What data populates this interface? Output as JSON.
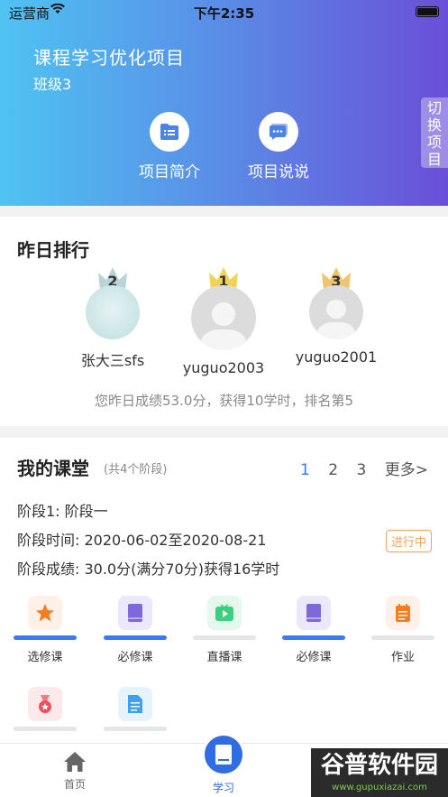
{
  "status_bar": {
    "carrier": "运营商",
    "time": "下午2:35"
  },
  "header": {
    "project_title": "课程学习优化项目",
    "class_name": "班级3",
    "buttons": [
      {
        "label": "项目简介",
        "icon": "list-icon"
      },
      {
        "label": "项目说说",
        "icon": "chat-icon"
      }
    ],
    "switch_label": "切换项目"
  },
  "ranking": {
    "title": "昨日排行",
    "items": [
      {
        "rank": "2",
        "name": "张大三sfs"
      },
      {
        "rank": "1",
        "name": "yuguo2003"
      },
      {
        "rank": "3",
        "name": "yuguo2001"
      }
    ],
    "summary": "您昨日成绩53.0分，获得10学时，排名第5"
  },
  "classroom": {
    "title": "我的课堂",
    "subtitle": "(共4个阶段)",
    "pages": [
      "1",
      "2",
      "3"
    ],
    "more": "更多>",
    "stage_name": "阶段1: 阶段一",
    "stage_time": "阶段时间: 2020-06-02至2020-08-21",
    "stage_score": "阶段成绩: 30.0分(满分70分)获得16学时",
    "status": "进行中",
    "courses": [
      {
        "label": "选修课",
        "icon": "star-icon",
        "progress": 1
      },
      {
        "label": "必修课",
        "icon": "book-icon",
        "progress": 1
      },
      {
        "label": "直播课",
        "icon": "video-icon",
        "progress": 0
      },
      {
        "label": "必修课",
        "icon": "book-icon",
        "progress": 1
      },
      {
        "label": "作业",
        "icon": "notebook-icon",
        "progress": 0
      },
      {
        "label": "",
        "icon": "medal-icon",
        "progress": 0
      },
      {
        "label": "",
        "icon": "document-icon",
        "progress": 0
      }
    ]
  },
  "tabbar": {
    "home": "首页",
    "study": "学习"
  },
  "watermark": {
    "text": "谷普软件园",
    "url": "www.gupuxiazai.com"
  },
  "colors": {
    "accent": "#2f6de0",
    "gradient_start": "#4fc3f2",
    "gradient_end": "#6a4fd8",
    "status_tag": "#f5a25d"
  }
}
